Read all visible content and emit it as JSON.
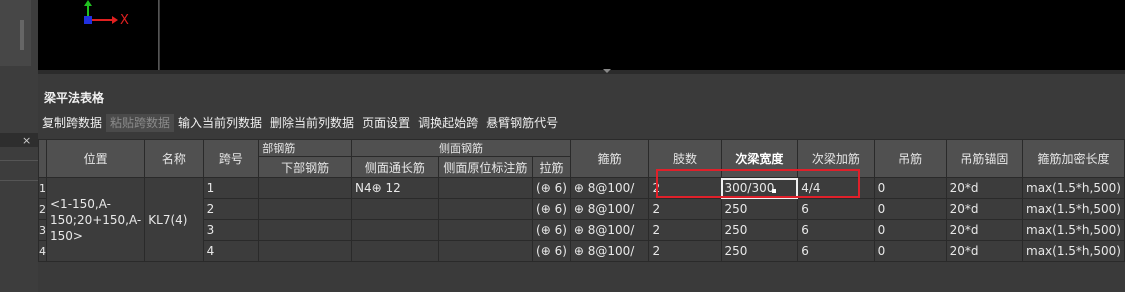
{
  "viewport": {
    "axis_x_label": "X"
  },
  "left_panel": {
    "close_glyph": "×"
  },
  "panel": {
    "title": "梁平法表格"
  },
  "toolbar": {
    "items": [
      {
        "label": "复制跨数据",
        "enabled": true
      },
      {
        "label": "粘贴跨数据",
        "enabled": false
      },
      {
        "label": "输入当前列数据",
        "enabled": true
      },
      {
        "label": "删除当前列数据",
        "enabled": true
      },
      {
        "label": "页面设置",
        "enabled": true
      },
      {
        "label": "调换起始跨",
        "enabled": true
      },
      {
        "label": "悬臂钢筋代号",
        "enabled": true
      }
    ]
  },
  "table": {
    "headers_top": {
      "position": "位置",
      "name": "名称",
      "span": "跨号",
      "top_rebar_partial": "部钢筋",
      "side_rebar": "侧面钢筋",
      "stirrup": "箍筋",
      "legs": "肢数",
      "sec_beam_width": "次梁宽度",
      "sec_beam_add": "次梁加筋",
      "hanger": "吊筋",
      "hanger_anchor": "吊筋锚固",
      "stirrup_dense_len": "箍筋加密长度"
    },
    "headers_sub": {
      "bottom_rebar": "下部钢筋",
      "side_through": "侧面通长筋",
      "side_in_situ": "侧面原位标注筋",
      "tie": "拉筋"
    },
    "position_text": "<1-150,A-150;20+150,A-150>",
    "name_text": "KL7(4)",
    "row_numbers": [
      "1",
      "2",
      "3",
      "4"
    ],
    "rows": [
      {
        "span": "1",
        "bottom": "",
        "side_through": "N4⊕ 12",
        "side_in_situ": "",
        "tie": "(⊕ 6)",
        "stirrup": "⊕ 8@100/",
        "legs": "2",
        "sec_width": "300/300",
        "sec_add": "4/4",
        "hanger": "0",
        "anchor": "20*d",
        "dense": "max(1.5*h,500)"
      },
      {
        "span": "2",
        "bottom": "",
        "side_through": "",
        "side_in_situ": "",
        "tie": "(⊕ 6)",
        "stirrup": "⊕ 8@100/",
        "legs": "2",
        "sec_width": "250",
        "sec_add": "6",
        "hanger": "0",
        "anchor": "20*d",
        "dense": "max(1.5*h,500)"
      },
      {
        "span": "3",
        "bottom": "",
        "side_through": "",
        "side_in_situ": "",
        "tie": "(⊕ 6)",
        "stirrup": "⊕ 8@100/",
        "legs": "2",
        "sec_width": "250",
        "sec_add": "6",
        "hanger": "0",
        "anchor": "20*d",
        "dense": "max(1.5*h,500)"
      },
      {
        "span": "4",
        "bottom": "",
        "side_through": "",
        "side_in_situ": "",
        "tie": "(⊕ 6)",
        "stirrup": "⊕ 8@100/",
        "legs": "2",
        "sec_width": "250",
        "sec_add": "6",
        "hanger": "0",
        "anchor": "20*d",
        "dense": "max(1.5*h,500)"
      }
    ]
  },
  "colors": {
    "highlight_box": "#e0202a",
    "axis_x": "#e02020",
    "axis_y": "#20c020",
    "origin": "#2030e0"
  }
}
